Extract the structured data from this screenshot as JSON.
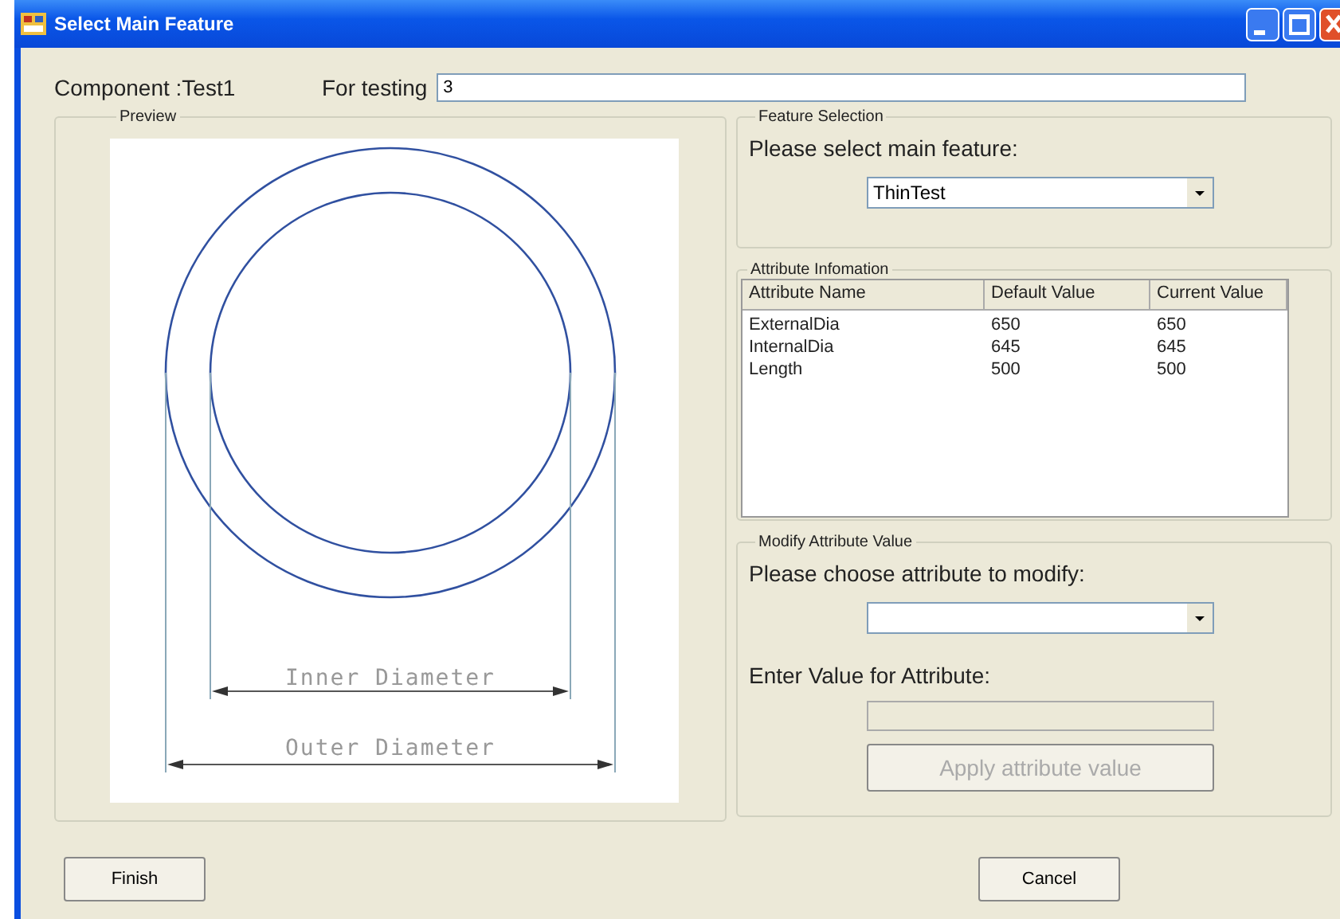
{
  "window": {
    "title": "Select Main Feature"
  },
  "header": {
    "component_label": "Component :Test1",
    "testing_label": "For testing",
    "testing_value": "3"
  },
  "preview": {
    "legend": "Preview",
    "inner_label": "Inner Diameter",
    "outer_label": "Outer Diameter"
  },
  "feature_selection": {
    "legend": "Feature Selection",
    "prompt": "Please select main feature:",
    "value": "ThinTest"
  },
  "attribute_information": {
    "legend": "Attribute Infomation",
    "columns": [
      "Attribute Name",
      "Default Value",
      "Current Value"
    ],
    "rows": [
      [
        "ExternalDia",
        "650",
        "650"
      ],
      [
        "InternalDia",
        "645",
        "645"
      ],
      [
        "Length",
        "500",
        "500"
      ]
    ]
  },
  "modify": {
    "legend": "Modify Attribute Value",
    "prompt": "Please choose attribute to modify:",
    "value_label": "Enter Value for Attribute:",
    "value_field": {
      "disabled": true
    },
    "apply_button": {
      "label": "Apply attribute value",
      "disabled": true
    }
  },
  "buttons": [
    {
      "label": "Finish"
    },
    {
      "label": "Cancel"
    }
  ]
}
